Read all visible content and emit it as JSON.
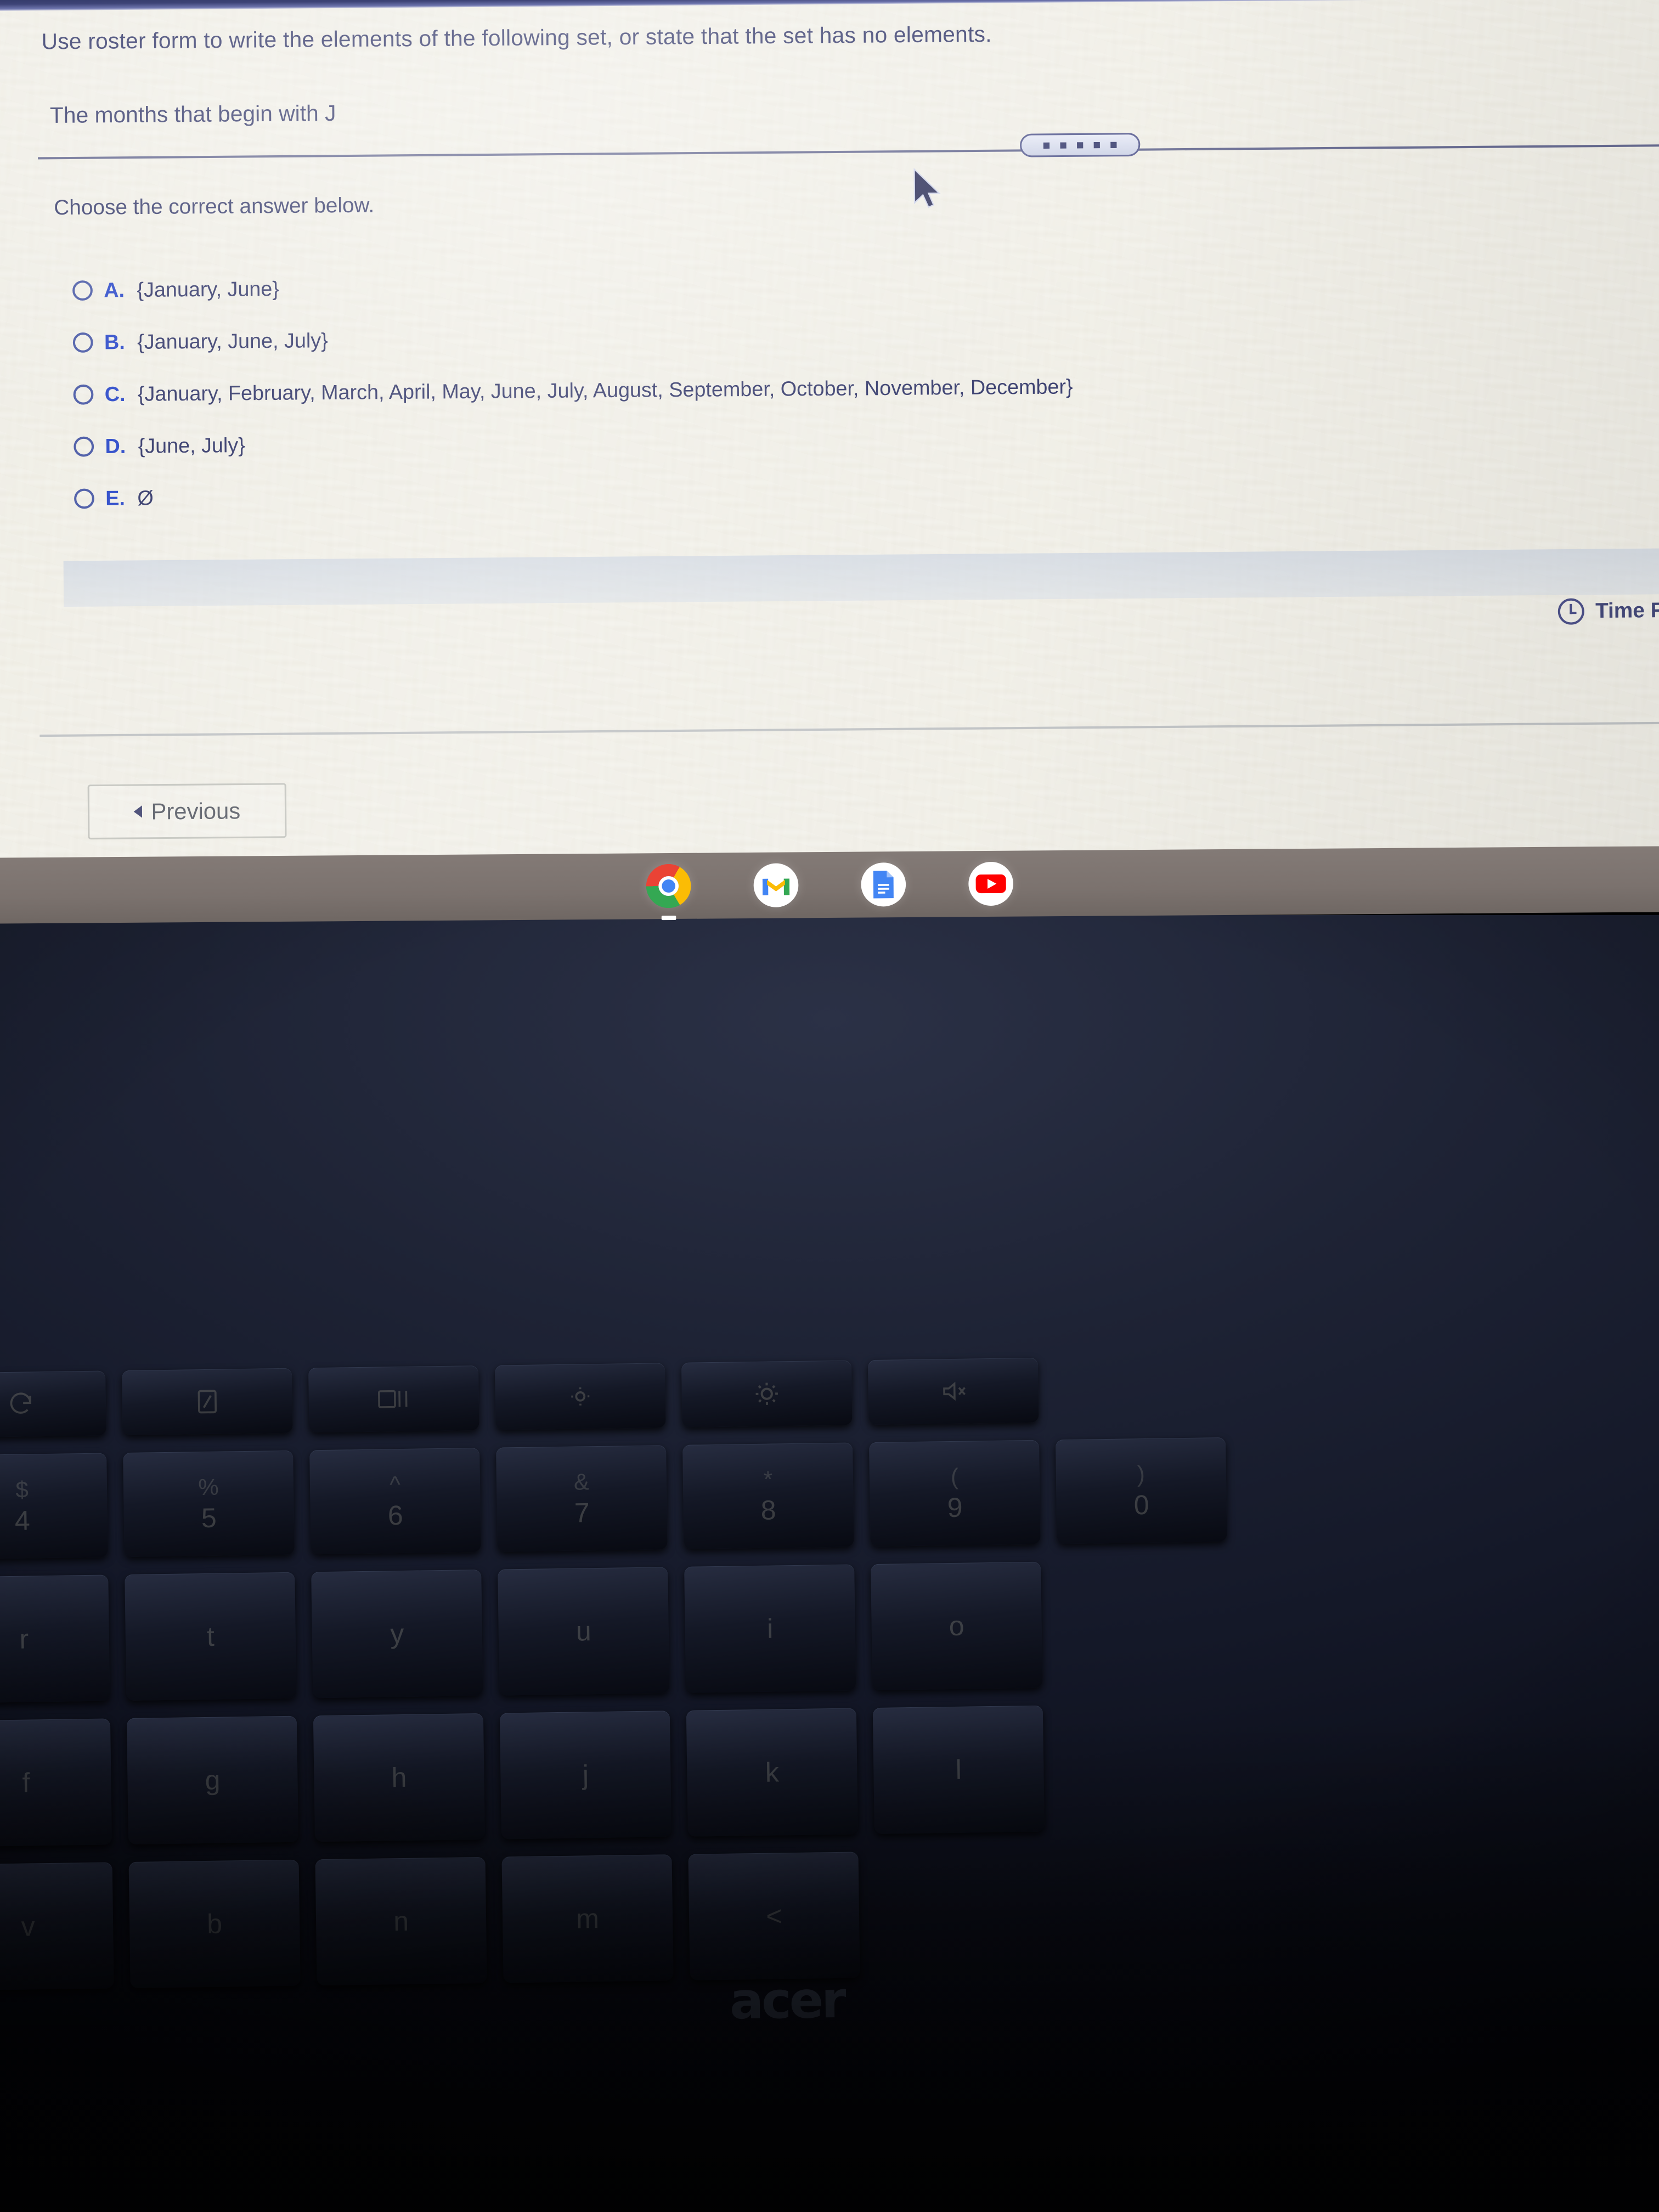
{
  "browser": {
    "chrome_strip_color": "#3d4376"
  },
  "exam": {
    "question_prompt": "Use roster form to write the elements of the following set, or state that the set has no elements.",
    "question_subject": "The months that begin with J",
    "instruction": "Choose the correct answer below.",
    "splitter": {
      "name": "panel-splitter-grip",
      "dots": 5
    },
    "options": [
      {
        "letter": "A.",
        "text": "{January, June}",
        "selected": false
      },
      {
        "letter": "B.",
        "text": "{January, June, July}",
        "selected": false
      },
      {
        "letter": "C.",
        "text": "{January, February, March, April, May, June, July, August, September, October, November, December}",
        "selected": false
      },
      {
        "letter": "D.",
        "text": "{June, July}",
        "selected": false
      },
      {
        "letter": "E.",
        "text": "Ø",
        "selected": false
      }
    ],
    "timer": {
      "icon": "clock-icon",
      "label": "Time Rema"
    },
    "previous_button": {
      "label": "Previous",
      "arrow": "◂"
    },
    "colors": {
      "page_bg": "#edebe2",
      "text": "#353a6b",
      "option_letter": "#2b49c9",
      "radio_border": "#4a5aa6"
    }
  },
  "shelf": {
    "background": "#7b726e",
    "icons": [
      {
        "name": "chrome-icon",
        "label": "Chrome",
        "active": true
      },
      {
        "name": "gmail-icon",
        "label": "Gmail",
        "active": false
      },
      {
        "name": "google-docs-icon",
        "label": "Docs",
        "active": false
      },
      {
        "name": "youtube-icon",
        "label": "YouTube",
        "active": false
      }
    ]
  },
  "laptop": {
    "brand": "acer",
    "keyboard": {
      "function_row": [
        {
          "icon": "reload-icon",
          "label": "reload"
        },
        {
          "icon": "fullscreen-icon",
          "label": "fullscreen"
        },
        {
          "icon": "overview-windows-icon",
          "label": "overview"
        },
        {
          "icon": "brightness-down-icon",
          "label": "brightness down"
        },
        {
          "icon": "brightness-up-icon",
          "label": "brightness up"
        },
        {
          "icon": "mute-icon",
          "label": "mute"
        }
      ],
      "number_row": [
        {
          "sup": "$",
          "main": "4"
        },
        {
          "sup": "%",
          "main": "5"
        },
        {
          "sup": "^",
          "main": "6"
        },
        {
          "sup": "&",
          "main": "7"
        },
        {
          "sup": "*",
          "main": "8"
        },
        {
          "sup": "(",
          "main": "9"
        },
        {
          "sup": ")",
          "main": "0"
        }
      ],
      "home_row_upper": [
        {
          "main": "r"
        },
        {
          "main": "t"
        },
        {
          "main": "y"
        },
        {
          "main": "u"
        },
        {
          "main": "i"
        },
        {
          "main": "o"
        }
      ],
      "home_row_middle": [
        {
          "main": "f"
        },
        {
          "main": "g"
        },
        {
          "main": "h"
        },
        {
          "main": "j"
        },
        {
          "main": "k"
        },
        {
          "main": "l"
        }
      ],
      "bottom_row": [
        {
          "main": "v"
        },
        {
          "main": "b"
        },
        {
          "main": "n"
        },
        {
          "main": "m"
        },
        {
          "main": "<"
        }
      ]
    }
  }
}
